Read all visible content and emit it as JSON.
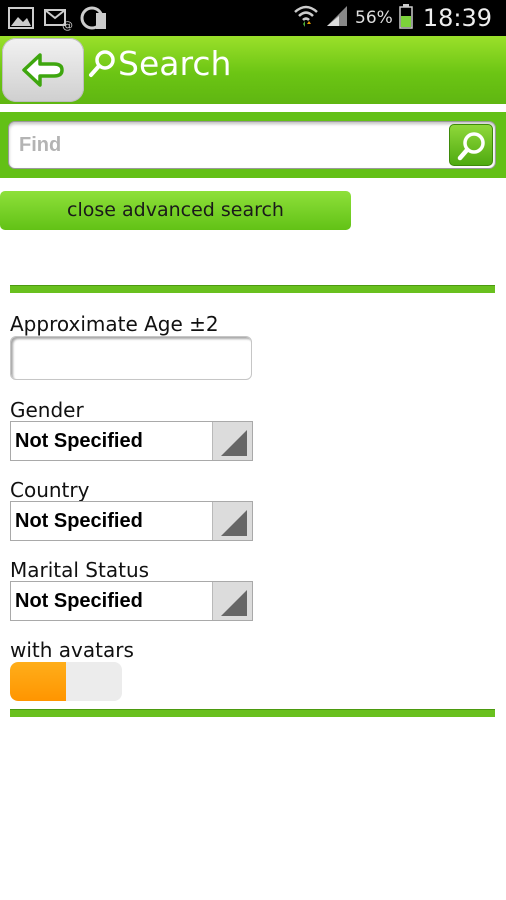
{
  "status_bar": {
    "battery_percent": "56%",
    "time": "18:39",
    "icons": [
      "picture-icon",
      "mail-icon",
      "sync-icon",
      "wifi-icon",
      "signal-icon",
      "battery-icon"
    ]
  },
  "app_bar": {
    "title": "Search",
    "back_icon": "back-arrow-icon",
    "title_icon": "search-icon",
    "accent": "#6cc514"
  },
  "search": {
    "placeholder": "Find",
    "value": ""
  },
  "advanced": {
    "toggle_label": "close advanced search"
  },
  "form": {
    "age_label": "Approximate Age ±2",
    "age_value": "",
    "gender_label": "Gender",
    "gender_value": "Not Specified",
    "country_label": "Country",
    "country_value": "Not Specified",
    "marital_label": "Marital Status",
    "marital_value": "Not Specified",
    "avatars_label": "with avatars",
    "avatars_on": true,
    "toggle_color": "#ff9c0a"
  }
}
